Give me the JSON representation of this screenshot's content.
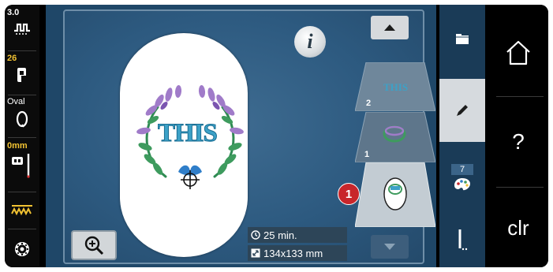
{
  "status": {
    "stitch_length": "3.0",
    "needle_number": "26",
    "hoop_name": "Oval",
    "presser_height": "0mm"
  },
  "info": {
    "time": "25 min.",
    "size": "134x133 mm"
  },
  "design": {
    "text": "THIS"
  },
  "layers": [
    {
      "number": "2",
      "label": "THIS"
    },
    {
      "number": "1",
      "label": ""
    }
  ],
  "callout": "1",
  "tab_badge": "7",
  "clear_label": "clr",
  "help_label": "?",
  "colors": {
    "screen_blue": "#1f4768",
    "callout_red": "#c8262b",
    "tab_active": "#d6dade"
  }
}
